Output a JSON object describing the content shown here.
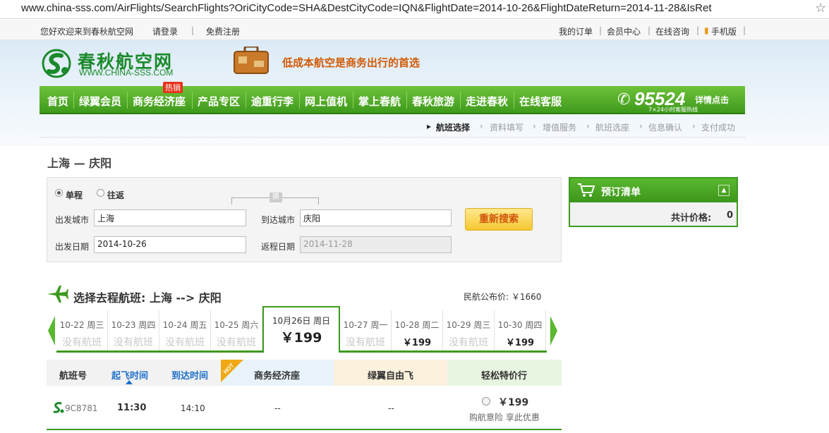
{
  "browser": {
    "url": "www.china-sss.com/AirFlights/SearchFlights?OriCityCode=SHA&DestCityCode=IQN&FlightDate=2014-10-26&FlightDateReturn=2014-11-28&IsRet"
  },
  "topbar": {
    "welcome": "您好欢迎来到春秋航空网",
    "login": "请登录",
    "register": "免费注册",
    "my_orders": "我的订单",
    "member_center": "会员中心",
    "online_consult": "在线咨询",
    "mobile": "手机版"
  },
  "header": {
    "logo_cn": "春秋航空网",
    "logo_en": "WWW.CHINA-SSS.COM",
    "slogan": "低成本航空是商务出行的首选",
    "hot_badge": "热销",
    "hotline_number": "95524",
    "hotline_detail": "详情点击",
    "hotline_sub": "7×24小时客服热线"
  },
  "nav": {
    "items": [
      "首页",
      "绿翼会员",
      "商务经济座",
      "产品专区",
      "逾重行李",
      "网上值机",
      "掌上春航",
      "春秋旅游",
      "走进春秋",
      "在线客服"
    ]
  },
  "steps": [
    "航班选择",
    "资料填写",
    "增值服务",
    "航班选座",
    "信息确认",
    "支付成功"
  ],
  "route_title": "上海 — 庆阳",
  "search": {
    "oneway": "单程",
    "roundtrip": "往返",
    "swap": "换",
    "from_label": "出发城市",
    "from_value": "上海",
    "to_label": "到达城市",
    "to_value": "庆阳",
    "depart_label": "出发日期",
    "depart_value": "2014-10-26",
    "return_label": "返程日期",
    "return_value": "2014-11-28",
    "research_button": "重新搜索"
  },
  "cart": {
    "title": "预订清单",
    "total_label": "共计价格:",
    "total_value": "0"
  },
  "select": {
    "title": "选择去程航班: 上海 --> 庆阳",
    "official_price": "民航公布价: ￥1660"
  },
  "days": [
    {
      "date": "10-22 周三",
      "price": "没有航班",
      "has": false
    },
    {
      "date": "10-23 周四",
      "price": "没有航班",
      "has": false
    },
    {
      "date": "10-24 周五",
      "price": "没有航班",
      "has": false
    },
    {
      "date": "10-25 周六",
      "price": "没有航班",
      "has": false
    },
    {
      "date": "10月26日 周日",
      "price": "￥199",
      "has": true
    },
    {
      "date": "10-27 周一",
      "price": "没有航班",
      "has": false
    },
    {
      "date": "10-28 周二",
      "price": "￥199",
      "has": true
    },
    {
      "date": "10-29 周三",
      "price": "没有航班",
      "has": false
    },
    {
      "date": "10-30 周四",
      "price": "￥199",
      "has": true
    }
  ],
  "table": {
    "headers": {
      "flight_no": "航班号",
      "depart_time": "起飞时间",
      "arrive_time": "到达时间",
      "business": "商务经济座",
      "green_free": "绿翼自由飞",
      "easy_price": "轻松特价行"
    },
    "hot_tag": "HOT",
    "rows": [
      {
        "flight_no": "9C8781",
        "depart_time": "11:30",
        "arrive_time": "14:10",
        "business": "--",
        "green_free": "--",
        "easy_price": "￥199",
        "easy_note": "购航意险 享此优惠"
      }
    ]
  },
  "colors": {
    "brand_green": "#3d9a1f",
    "accent_orange": "#d15a05",
    "link_blue": "#1d6fc9"
  }
}
